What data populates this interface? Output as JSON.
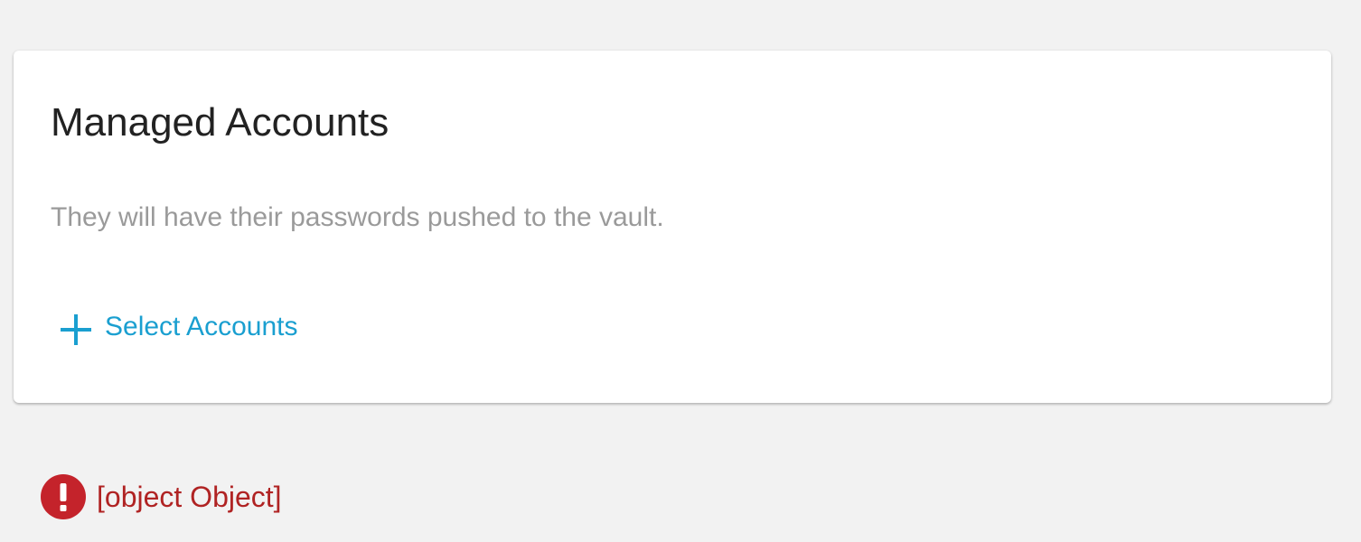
{
  "card": {
    "title": "Managed Accounts",
    "description": "They will have their passwords pushed to the vault.",
    "select_button_label": "Select Accounts",
    "select_button_icon": "plus-icon",
    "accent_color": "#1a9fd0"
  },
  "error": {
    "icon": "exclamation-circle-icon",
    "message": "[object Object]",
    "color": "#b02323"
  }
}
